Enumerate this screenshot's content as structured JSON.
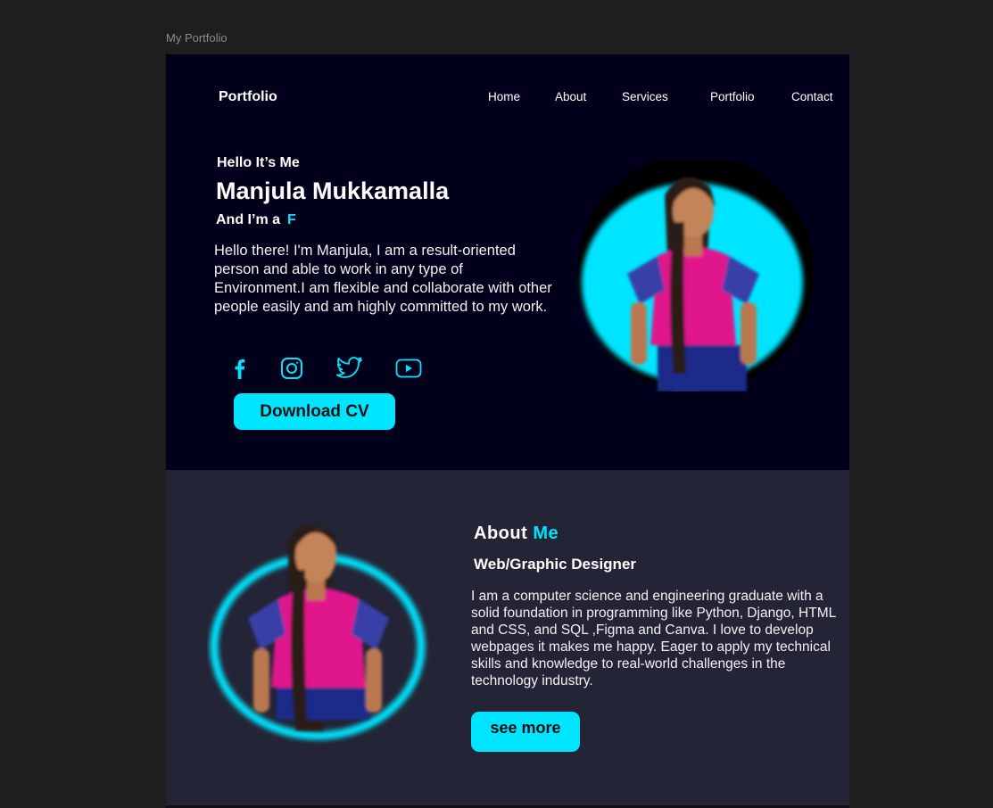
{
  "window": {
    "frame_label": "My Portfolio"
  },
  "header": {
    "brand": "Portfolio",
    "nav": [
      {
        "label": "Home"
      },
      {
        "label": "About"
      },
      {
        "label": "Services"
      },
      {
        "label": "Portfolio"
      },
      {
        "label": "Contact"
      }
    ]
  },
  "hero": {
    "greeting": "Hello It’s Me",
    "name": "Manjula Mukkamalla",
    "role_prefix": "And I’m a",
    "role_typed": "F",
    "intro": "Hello there! I'm Manjula, I am a result-oriented person and able to work in any type of Environment.I am flexible and collaborate with other people easily and am highly committed to my work.",
    "social_icons": [
      "facebook-icon",
      "instagram-icon",
      "twitter-icon",
      "youtube-icon"
    ],
    "cv_button": "Download CV"
  },
  "about": {
    "title_word": "About",
    "title_accent": "Me",
    "subtitle": "Web/Graphic Designer",
    "text": "I am a computer science and engineering graduate with a solid foundation in programming like Python, Django, HTML and CSS, and SQL ,Figma and Canva. I love to develop webpages it makes me happy. Eager to apply my technical skills and knowledge to real-world challenges in the technology industry.",
    "button": "see more"
  },
  "colors": {
    "accent": "#00e5ff",
    "hero_bg": "#01001a",
    "about_bg": "#232436",
    "canvas_bg": "#1e1e1e"
  }
}
